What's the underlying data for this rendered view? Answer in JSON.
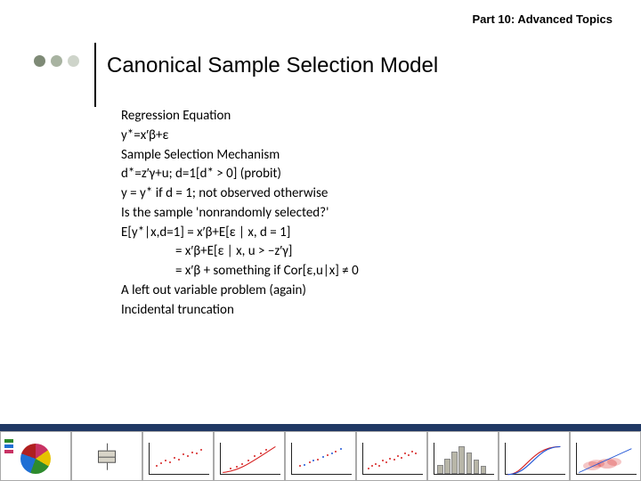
{
  "header": {
    "part_label": "Part 10: Advanced Topics"
  },
  "title": "Canonical Sample Selection Model",
  "lines": {
    "l1": "Regression Equation",
    "l2": "y*=x′β+ε",
    "l3": "Sample Selection Mechanism",
    "l4": "d*=z′γ+u; d=1[d* > 0] (probit)",
    "l5": "y = y* if d = 1; not observed otherwise",
    "l6": "Is the sample 'nonrandomly selected?'",
    "l7": "E[y*|x,d=1] = x′β+E[ε | x, d = 1]",
    "l8": "                  = x′β+E[ε | x, u > −z′γ]",
    "l9": "                  = x′β + something if Cor[ε,u|x] ≠ 0",
    "l10": "A left out variable problem (again)",
    "l11": "Incidental truncation"
  },
  "bullets": {
    "colors": [
      "#7e8a76",
      "#a8b3a1",
      "#ced4ca"
    ]
  },
  "accent_bar_color": "#203864"
}
